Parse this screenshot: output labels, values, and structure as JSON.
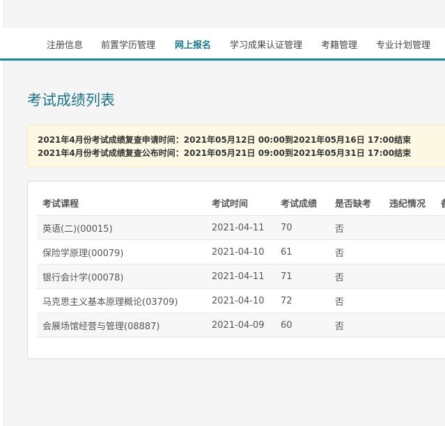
{
  "nav": {
    "items": [
      {
        "label": "注册信息",
        "active": false
      },
      {
        "label": "前置学历管理",
        "active": false
      },
      {
        "label": "网上报名",
        "active": true
      },
      {
        "label": "学习成果认证管理",
        "active": false
      },
      {
        "label": "考籍管理",
        "active": false
      },
      {
        "label": "专业计划管理",
        "active": false
      }
    ]
  },
  "page": {
    "title": "考试成绩列表"
  },
  "notice": {
    "lines": [
      "2021年4月份考试成绩复查申请时间：2021年05月12日 00:00到2021年05月16日 17:00结束",
      "2021年4月份考试成绩复查公布时间：2021年05月21日 09:00到2021年05月31日 17:00结束"
    ]
  },
  "table": {
    "headers": [
      "考试课程",
      "考试时间",
      "考试成绩",
      "是否缺考",
      "违纪情况",
      "备"
    ],
    "rows": [
      {
        "course": "英语(二)(00015)",
        "date": "2021-04-11",
        "score": "70",
        "absent": "否",
        "violation": ""
      },
      {
        "course": "保险学原理(00079)",
        "date": "2021-04-10",
        "score": "61",
        "absent": "否",
        "violation": ""
      },
      {
        "course": "银行会计学(00078)",
        "date": "2021-04-11",
        "score": "71",
        "absent": "否",
        "violation": ""
      },
      {
        "course": "马克思主义基本原理概论(03709)",
        "date": "2021-04-10",
        "score": "72",
        "absent": "否",
        "violation": ""
      },
      {
        "course": "会展场馆经营与管理(08887)",
        "date": "2021-04-09",
        "score": "60",
        "absent": "否",
        "violation": ""
      }
    ]
  },
  "colors": {
    "accent": "#17868a",
    "title": "#1a7386",
    "notice_bg": "#fcf8e3"
  }
}
